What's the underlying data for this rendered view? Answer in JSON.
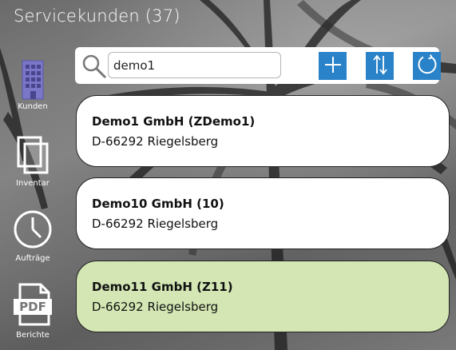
{
  "header": {
    "title": "Servicekunden (37)"
  },
  "sidebar": {
    "items": [
      {
        "label": "Kunden",
        "icon": "building-icon",
        "active": true
      },
      {
        "label": "Inventar",
        "icon": "copy-icon"
      },
      {
        "label": "Aufträge",
        "icon": "clock-icon"
      },
      {
        "label": "Berichte",
        "icon": "pdf-icon"
      }
    ]
  },
  "toolbar": {
    "search_value": "demo1",
    "add_icon": "plus-icon",
    "sort_icon": "sort-arrows-icon",
    "refresh_icon": "refresh-icon",
    "button_color": "#2a83c9"
  },
  "customers": [
    {
      "name": "Demo1 GmbH (ZDemo1)",
      "address": "D-66292 Riegelsberg",
      "selected": false
    },
    {
      "name": "Demo10 GmbH (10)",
      "address": "D-66292 Riegelsberg",
      "selected": false
    },
    {
      "name": "Demo11 GmbH (Z11)",
      "address": "D-66292 Riegelsberg",
      "selected": true
    }
  ],
  "colors": {
    "selected_card": "#d3e6b3",
    "card": "#ffffff"
  }
}
